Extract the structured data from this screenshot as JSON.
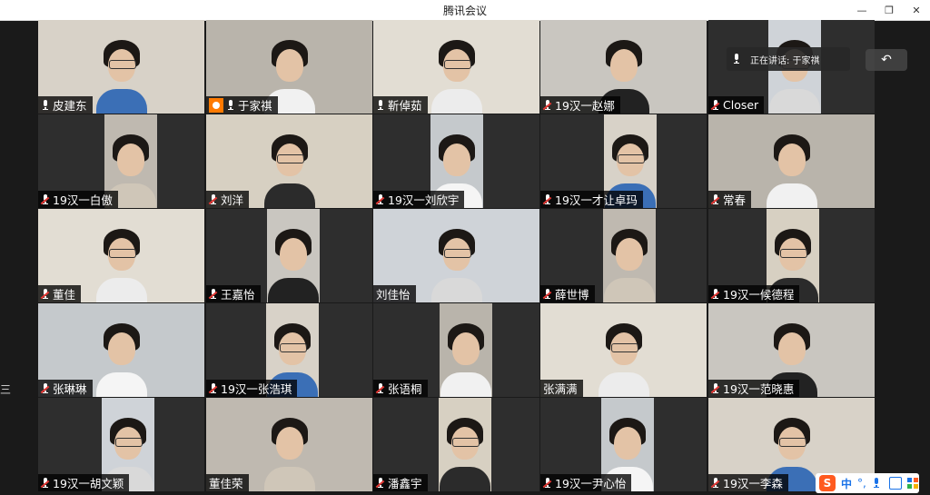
{
  "window": {
    "title": "腾讯会议",
    "minimize": "—",
    "restore": "❐",
    "close": "✕"
  },
  "speaking": {
    "label": "正在讲话: 于家祺"
  },
  "undo_icon": "↶",
  "edge_glyph": "三",
  "ime": {
    "logo": "S",
    "lang": "中",
    "punct": "°,"
  },
  "participants": [
    {
      "name": "皮建东",
      "mic": "on"
    },
    {
      "name": "于家祺",
      "mic": "on",
      "host": true,
      "speaking": true
    },
    {
      "name": "靳倬茹",
      "mic": "on"
    },
    {
      "name": "19汉一赵娜",
      "mic": "muted"
    },
    {
      "name": "Closer",
      "mic": "muted"
    },
    {
      "name": "19汉一白傲",
      "mic": "muted"
    },
    {
      "name": "刘洋",
      "mic": "muted"
    },
    {
      "name": "19汉一刘欣宇",
      "mic": "muted"
    },
    {
      "name": "19汉一才让卓玛",
      "mic": "muted"
    },
    {
      "name": "常春",
      "mic": "muted"
    },
    {
      "name": "董佳",
      "mic": "muted"
    },
    {
      "name": "王嘉怡",
      "mic": "muted"
    },
    {
      "name": "刘佳怡",
      "mic": "none"
    },
    {
      "name": "薛世博",
      "mic": "muted"
    },
    {
      "name": "19汉一候德程",
      "mic": "muted"
    },
    {
      "name": "张琳琳",
      "mic": "muted"
    },
    {
      "name": "19汉一张浩琪",
      "mic": "muted"
    },
    {
      "name": "张语桐",
      "mic": "muted"
    },
    {
      "name": "张满满",
      "mic": "none"
    },
    {
      "name": "19汉一范晓惠",
      "mic": "muted"
    },
    {
      "name": "19汉一胡文颖",
      "mic": "muted"
    },
    {
      "name": "董佳荣",
      "mic": "none"
    },
    {
      "name": "潘鑫宇",
      "mic": "muted"
    },
    {
      "name": "19汉一尹心怡",
      "mic": "muted"
    },
    {
      "name": "19汉一李森",
      "mic": "muted"
    }
  ]
}
